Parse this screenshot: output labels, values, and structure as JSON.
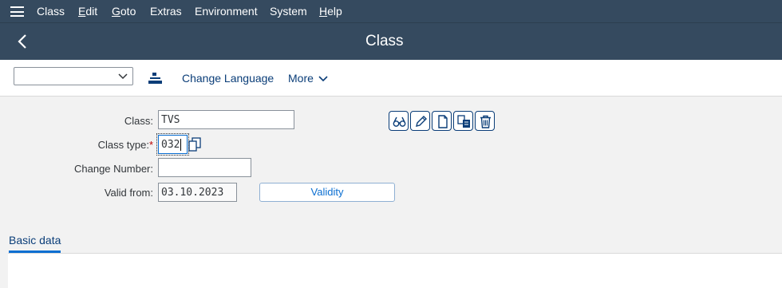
{
  "menu": {
    "items": [
      {
        "label_u": "",
        "label_rest": "Class",
        "u_first": "C"
      },
      {
        "label_u": "E",
        "label_rest": "dit"
      },
      {
        "label_u": "G",
        "label_rest": "oto"
      },
      {
        "label_u": "",
        "label_rest": "Extras"
      },
      {
        "label_u": "",
        "label_rest": "Environment"
      },
      {
        "label_u": "",
        "label_rest": "System"
      },
      {
        "label_u": "H",
        "label_rest": "elp"
      }
    ]
  },
  "titlebar": {
    "title": "Class"
  },
  "toolbar": {
    "dropdown_value": "",
    "change_language": "Change Language",
    "more": "More"
  },
  "form": {
    "class_label": "Class:",
    "class_value": "TVS",
    "class_type_label": "Class type:",
    "class_type_required": "*",
    "class_type_value": "032",
    "change_number_label": "Change Number:",
    "change_number_value": "",
    "valid_from_label": "Valid from:",
    "valid_from_value": "03.10.2023",
    "validity_button": "Validity"
  },
  "tabs": {
    "basic_data": "Basic data"
  },
  "icons": {
    "display": "glasses-icon",
    "change": "pencil-icon",
    "create": "document-icon",
    "copy": "copy-icon",
    "delete": "trash-icon"
  },
  "colors": {
    "shell": "#354a5f",
    "accent": "#0a6ed1",
    "link": "#0a3d78",
    "required": "#bb0000"
  }
}
